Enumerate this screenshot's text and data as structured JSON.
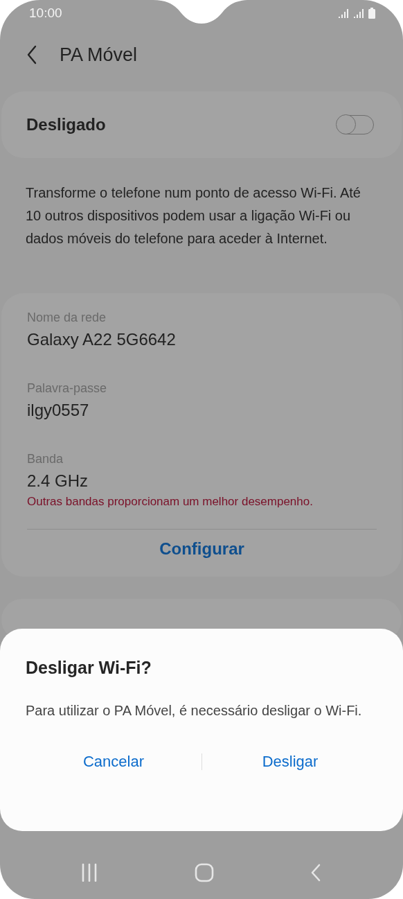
{
  "status_bar": {
    "time": "10:00"
  },
  "header": {
    "title": "PA Móvel"
  },
  "master_switch": {
    "label": "Desligado",
    "on": false
  },
  "description": "Transforme o telefone num ponto de acesso Wi-Fi. Até 10 outros dispositivos podem usar a ligação Wi-Fi ou dados móveis do telefone para aceder à Internet.",
  "settings": {
    "fields": [
      {
        "label": "Nome da rede",
        "value": "Galaxy A22 5G6642"
      },
      {
        "label": "Palavra-passe",
        "value": "ilgy0557"
      },
      {
        "label": "Banda",
        "value": "2.4 GHz",
        "warning": "Outras bandas proporcionam um melhor desempenho."
      }
    ],
    "action": "Configurar"
  },
  "dialog": {
    "title": "Desligar Wi-Fi?",
    "message": "Para utilizar o PA Móvel, é necessário desligar o Wi-Fi.",
    "buttons": [
      "Cancelar",
      "Desligar"
    ]
  }
}
